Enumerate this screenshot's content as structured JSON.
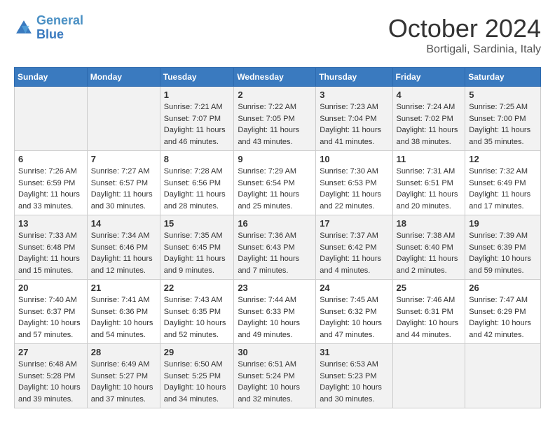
{
  "header": {
    "logo_general": "General",
    "logo_blue": "Blue",
    "month_title": "October 2024",
    "location": "Bortigali, Sardinia, Italy"
  },
  "days_of_week": [
    "Sunday",
    "Monday",
    "Tuesday",
    "Wednesday",
    "Thursday",
    "Friday",
    "Saturday"
  ],
  "weeks": [
    [
      {
        "day": "",
        "sunrise": "",
        "sunset": "",
        "daylight": ""
      },
      {
        "day": "",
        "sunrise": "",
        "sunset": "",
        "daylight": ""
      },
      {
        "day": "1",
        "sunrise": "Sunrise: 7:21 AM",
        "sunset": "Sunset: 7:07 PM",
        "daylight": "Daylight: 11 hours and 46 minutes."
      },
      {
        "day": "2",
        "sunrise": "Sunrise: 7:22 AM",
        "sunset": "Sunset: 7:05 PM",
        "daylight": "Daylight: 11 hours and 43 minutes."
      },
      {
        "day": "3",
        "sunrise": "Sunrise: 7:23 AM",
        "sunset": "Sunset: 7:04 PM",
        "daylight": "Daylight: 11 hours and 41 minutes."
      },
      {
        "day": "4",
        "sunrise": "Sunrise: 7:24 AM",
        "sunset": "Sunset: 7:02 PM",
        "daylight": "Daylight: 11 hours and 38 minutes."
      },
      {
        "day": "5",
        "sunrise": "Sunrise: 7:25 AM",
        "sunset": "Sunset: 7:00 PM",
        "daylight": "Daylight: 11 hours and 35 minutes."
      }
    ],
    [
      {
        "day": "6",
        "sunrise": "Sunrise: 7:26 AM",
        "sunset": "Sunset: 6:59 PM",
        "daylight": "Daylight: 11 hours and 33 minutes."
      },
      {
        "day": "7",
        "sunrise": "Sunrise: 7:27 AM",
        "sunset": "Sunset: 6:57 PM",
        "daylight": "Daylight: 11 hours and 30 minutes."
      },
      {
        "day": "8",
        "sunrise": "Sunrise: 7:28 AM",
        "sunset": "Sunset: 6:56 PM",
        "daylight": "Daylight: 11 hours and 28 minutes."
      },
      {
        "day": "9",
        "sunrise": "Sunrise: 7:29 AM",
        "sunset": "Sunset: 6:54 PM",
        "daylight": "Daylight: 11 hours and 25 minutes."
      },
      {
        "day": "10",
        "sunrise": "Sunrise: 7:30 AM",
        "sunset": "Sunset: 6:53 PM",
        "daylight": "Daylight: 11 hours and 22 minutes."
      },
      {
        "day": "11",
        "sunrise": "Sunrise: 7:31 AM",
        "sunset": "Sunset: 6:51 PM",
        "daylight": "Daylight: 11 hours and 20 minutes."
      },
      {
        "day": "12",
        "sunrise": "Sunrise: 7:32 AM",
        "sunset": "Sunset: 6:49 PM",
        "daylight": "Daylight: 11 hours and 17 minutes."
      }
    ],
    [
      {
        "day": "13",
        "sunrise": "Sunrise: 7:33 AM",
        "sunset": "Sunset: 6:48 PM",
        "daylight": "Daylight: 11 hours and 15 minutes."
      },
      {
        "day": "14",
        "sunrise": "Sunrise: 7:34 AM",
        "sunset": "Sunset: 6:46 PM",
        "daylight": "Daylight: 11 hours and 12 minutes."
      },
      {
        "day": "15",
        "sunrise": "Sunrise: 7:35 AM",
        "sunset": "Sunset: 6:45 PM",
        "daylight": "Daylight: 11 hours and 9 minutes."
      },
      {
        "day": "16",
        "sunrise": "Sunrise: 7:36 AM",
        "sunset": "Sunset: 6:43 PM",
        "daylight": "Daylight: 11 hours and 7 minutes."
      },
      {
        "day": "17",
        "sunrise": "Sunrise: 7:37 AM",
        "sunset": "Sunset: 6:42 PM",
        "daylight": "Daylight: 11 hours and 4 minutes."
      },
      {
        "day": "18",
        "sunrise": "Sunrise: 7:38 AM",
        "sunset": "Sunset: 6:40 PM",
        "daylight": "Daylight: 11 hours and 2 minutes."
      },
      {
        "day": "19",
        "sunrise": "Sunrise: 7:39 AM",
        "sunset": "Sunset: 6:39 PM",
        "daylight": "Daylight: 10 hours and 59 minutes."
      }
    ],
    [
      {
        "day": "20",
        "sunrise": "Sunrise: 7:40 AM",
        "sunset": "Sunset: 6:37 PM",
        "daylight": "Daylight: 10 hours and 57 minutes."
      },
      {
        "day": "21",
        "sunrise": "Sunrise: 7:41 AM",
        "sunset": "Sunset: 6:36 PM",
        "daylight": "Daylight: 10 hours and 54 minutes."
      },
      {
        "day": "22",
        "sunrise": "Sunrise: 7:43 AM",
        "sunset": "Sunset: 6:35 PM",
        "daylight": "Daylight: 10 hours and 52 minutes."
      },
      {
        "day": "23",
        "sunrise": "Sunrise: 7:44 AM",
        "sunset": "Sunset: 6:33 PM",
        "daylight": "Daylight: 10 hours and 49 minutes."
      },
      {
        "day": "24",
        "sunrise": "Sunrise: 7:45 AM",
        "sunset": "Sunset: 6:32 PM",
        "daylight": "Daylight: 10 hours and 47 minutes."
      },
      {
        "day": "25",
        "sunrise": "Sunrise: 7:46 AM",
        "sunset": "Sunset: 6:31 PM",
        "daylight": "Daylight: 10 hours and 44 minutes."
      },
      {
        "day": "26",
        "sunrise": "Sunrise: 7:47 AM",
        "sunset": "Sunset: 6:29 PM",
        "daylight": "Daylight: 10 hours and 42 minutes."
      }
    ],
    [
      {
        "day": "27",
        "sunrise": "Sunrise: 6:48 AM",
        "sunset": "Sunset: 5:28 PM",
        "daylight": "Daylight: 10 hours and 39 minutes."
      },
      {
        "day": "28",
        "sunrise": "Sunrise: 6:49 AM",
        "sunset": "Sunset: 5:27 PM",
        "daylight": "Daylight: 10 hours and 37 minutes."
      },
      {
        "day": "29",
        "sunrise": "Sunrise: 6:50 AM",
        "sunset": "Sunset: 5:25 PM",
        "daylight": "Daylight: 10 hours and 34 minutes."
      },
      {
        "day": "30",
        "sunrise": "Sunrise: 6:51 AM",
        "sunset": "Sunset: 5:24 PM",
        "daylight": "Daylight: 10 hours and 32 minutes."
      },
      {
        "day": "31",
        "sunrise": "Sunrise: 6:53 AM",
        "sunset": "Sunset: 5:23 PM",
        "daylight": "Daylight: 10 hours and 30 minutes."
      },
      {
        "day": "",
        "sunrise": "",
        "sunset": "",
        "daylight": ""
      },
      {
        "day": "",
        "sunrise": "",
        "sunset": "",
        "daylight": ""
      }
    ]
  ]
}
